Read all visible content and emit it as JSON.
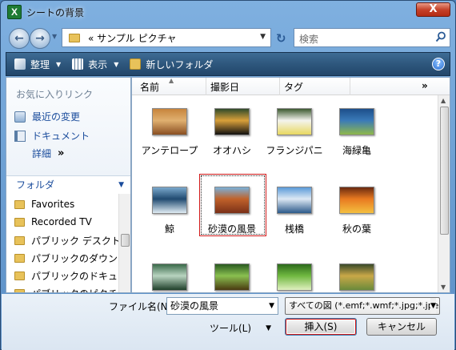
{
  "window": {
    "title": "シートの背景",
    "close_label": "X",
    "app_icon_letter": "X"
  },
  "address": {
    "path": "« サンプル ピクチャ",
    "search_placeholder": "検索"
  },
  "toolbar": {
    "organize": "整理",
    "view": "表示",
    "new_folder": "新しいフォルダ",
    "help": "?"
  },
  "left_pane": {
    "favorites_title": "お気に入りリンク",
    "links": [
      "最近の変更",
      "ドキュメント"
    ],
    "more": "詳細",
    "more_icon": "»",
    "folders_title": "フォルダ",
    "tree": [
      "Favorites",
      "Recorded TV",
      "パブリック デスクトッ",
      "パブリックのダウン",
      "パブリックのドキュ",
      "パブリックのピクチャ"
    ]
  },
  "columns": {
    "name": "名前",
    "date": "撮影日",
    "tags": "タグ",
    "more": "»"
  },
  "files": [
    {
      "label": "アンテロープ",
      "colors": [
        "#c7843c",
        "#e0b070",
        "#8a4f22"
      ]
    },
    {
      "label": "オオハシ",
      "colors": [
        "#2f4a2a",
        "#d9a03a",
        "#111111"
      ]
    },
    {
      "label": "フランジパニ",
      "colors": [
        "#3c5a30",
        "#f4f4ee",
        "#e8d860"
      ]
    },
    {
      "label": "海緑亀",
      "colors": [
        "#1d4f8a",
        "#3a7ab8",
        "#8fb84a"
      ]
    },
    {
      "label": "鯨",
      "colors": [
        "#7aa8cc",
        "#204a70",
        "#e0ecf4"
      ]
    },
    {
      "label": "砂漠の風景",
      "colors": [
        "#7ab0d8",
        "#c0622a",
        "#7a3018"
      ]
    },
    {
      "label": "桟橋",
      "colors": [
        "#5a9ad8",
        "#dce8f4",
        "#2c5a8a"
      ]
    },
    {
      "label": "秋の葉",
      "colors": [
        "#6a2a10",
        "#e87a20",
        "#f4c040"
      ]
    },
    {
      "label": "",
      "colors": [
        "#3a6a4a",
        "#b8d4c0",
        "#1f3f2a"
      ]
    },
    {
      "label": "",
      "colors": [
        "#2a5a20",
        "#8ac050",
        "#4a3a10"
      ]
    },
    {
      "label": "",
      "colors": [
        "#2c6a1c",
        "#70b840",
        "#e0f0c0"
      ]
    },
    {
      "label": "",
      "colors": [
        "#3a4a2a",
        "#c9a848",
        "#6a8a3a"
      ]
    }
  ],
  "selected_file": "砂漠の風景",
  "bottom": {
    "filename_label": "ファイル名(N):",
    "filename_value": "砂漠の風景",
    "filetype_value": "すべての図 (*.emf;*.wmf;*.jpg;*.jpe",
    "tools_label": "ツール(L)",
    "insert_label": "挿入(S)",
    "cancel_label": "キャンセル"
  }
}
